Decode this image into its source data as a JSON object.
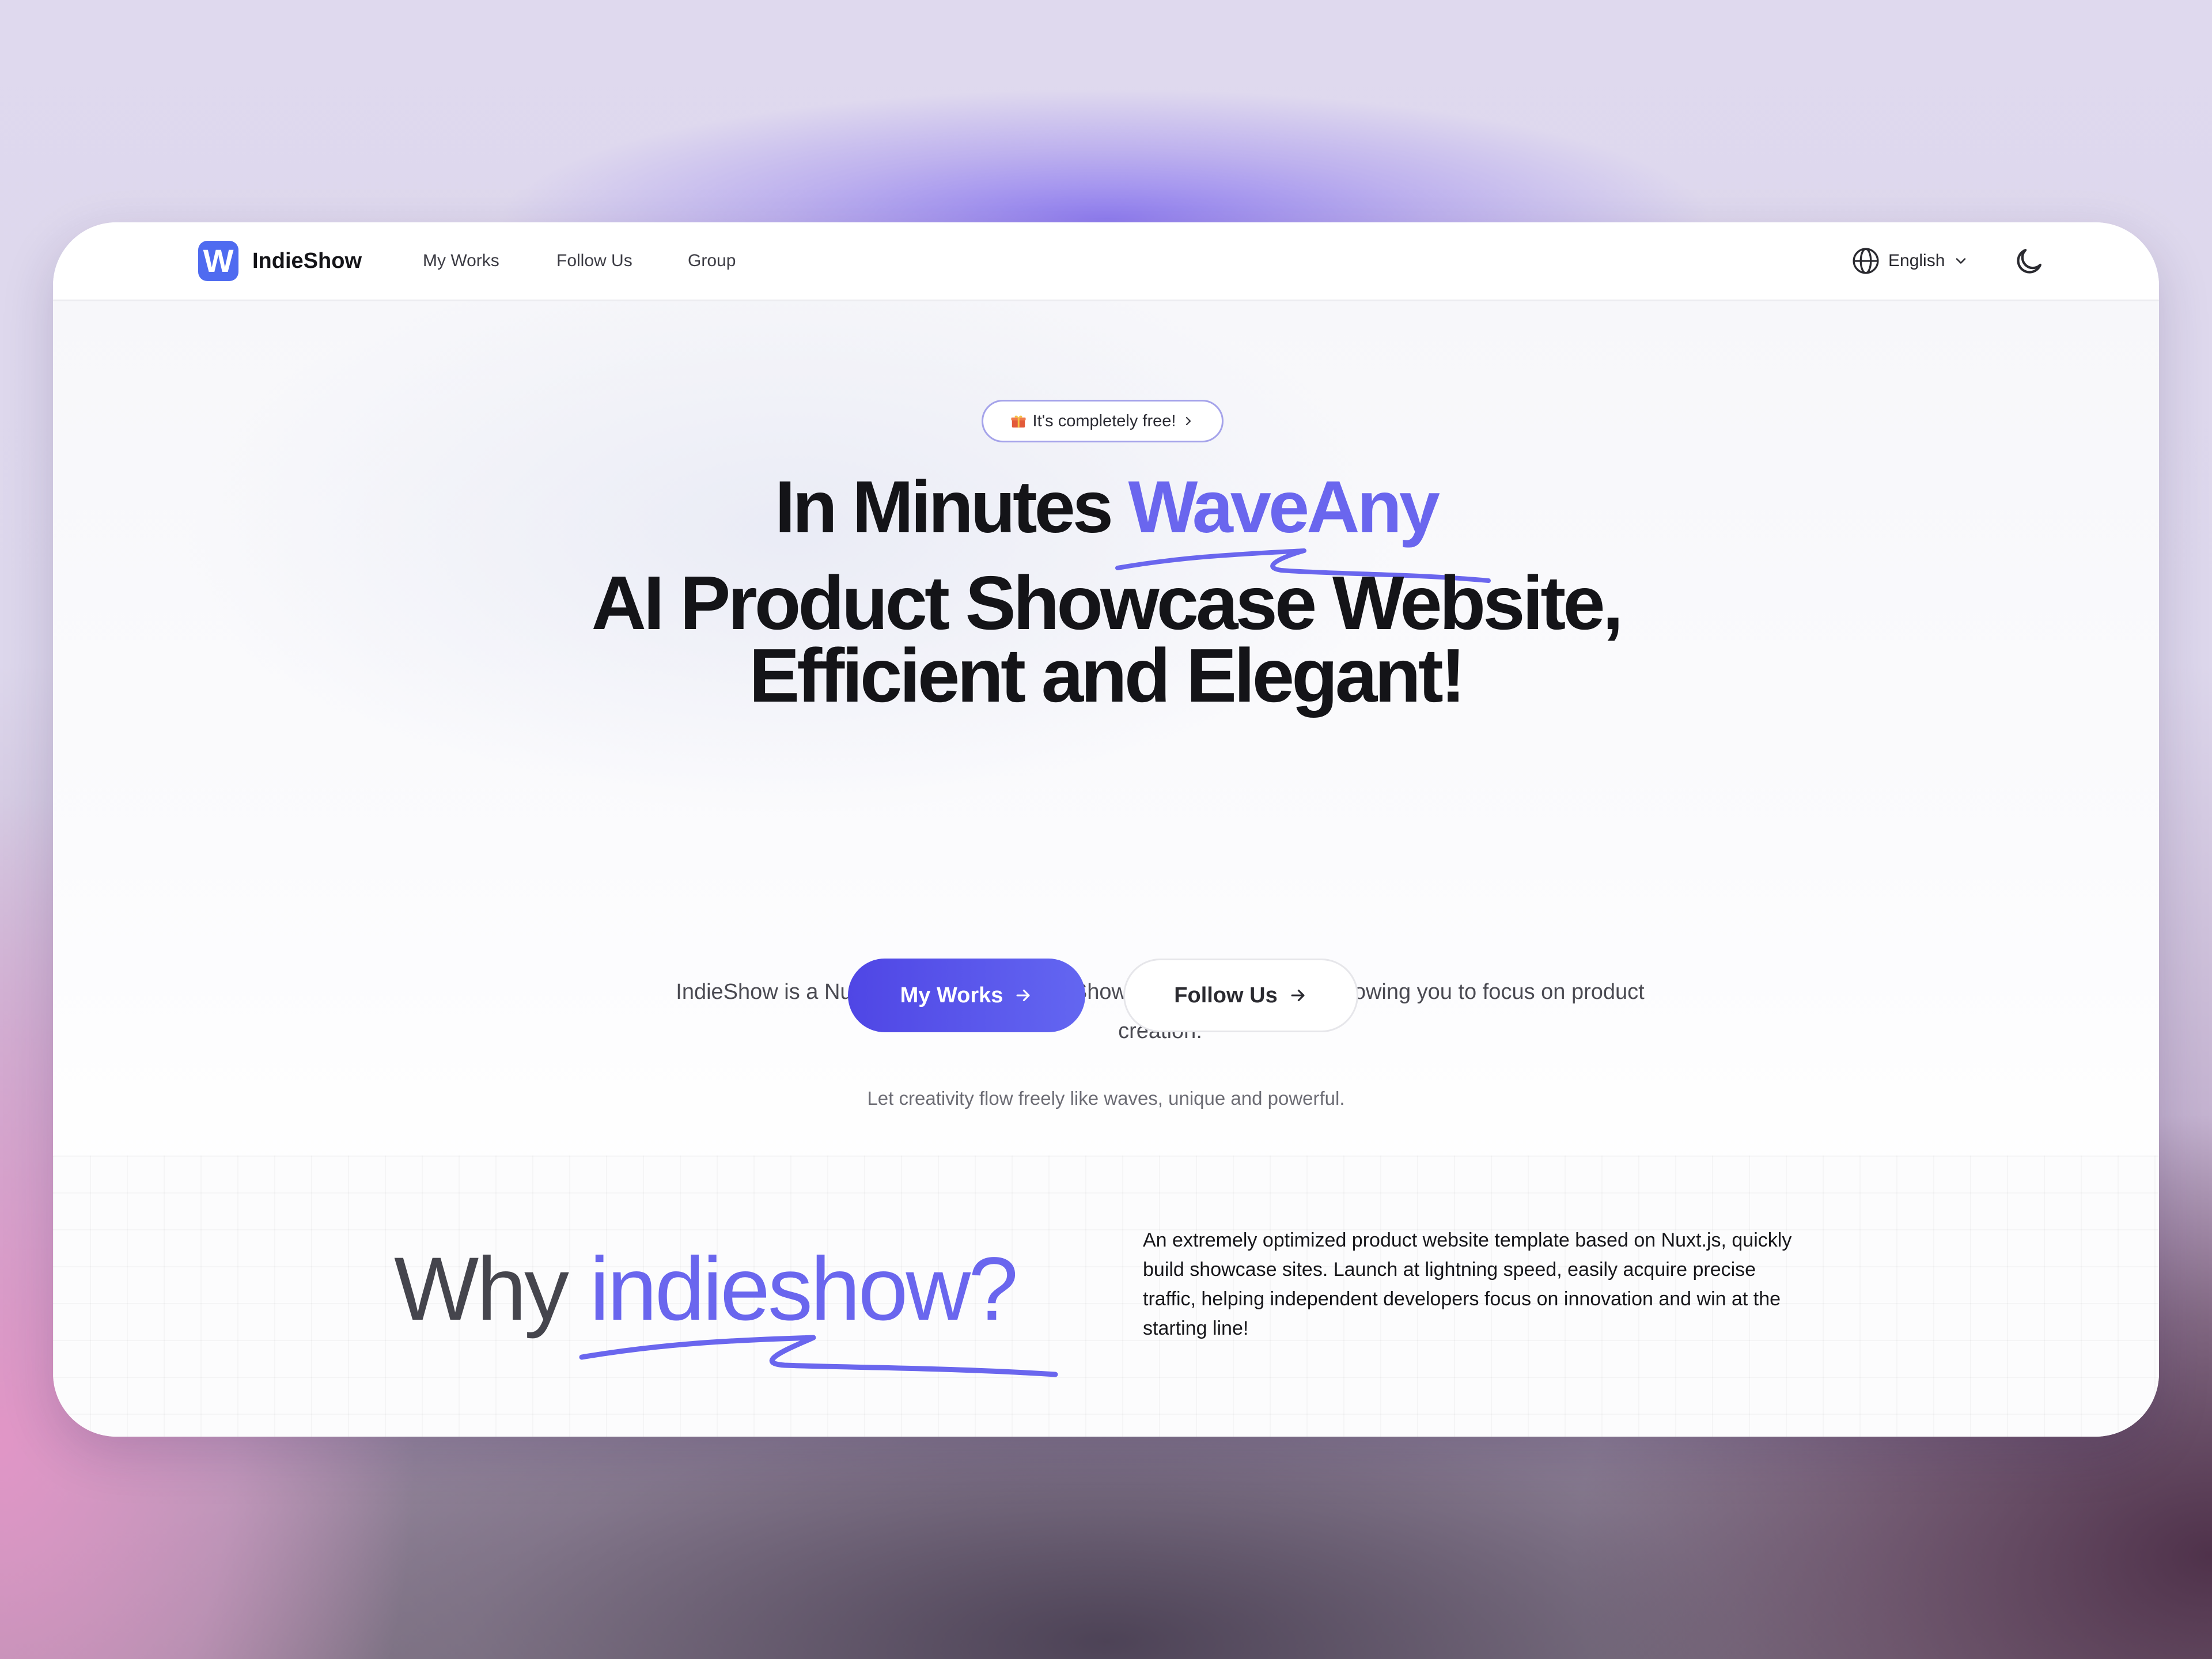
{
  "brand": {
    "logo_letter": "W",
    "name": "IndieShow",
    "accent": "#4f6bf0"
  },
  "nav": {
    "items": [
      "My Works",
      "Follow Us",
      "Group"
    ]
  },
  "header": {
    "language_label": "English",
    "globe_icon": "globe-icon",
    "theme_icon": "moon-icon"
  },
  "hero": {
    "badge": "It's completely free!",
    "title_line1_prefix": "In Minutes ",
    "title_line1_accent": "WaveAny",
    "title_line2": "AI Product Showcase Website,",
    "title_line3": "Efficient and Elegant!",
    "subtitle": "IndieShow is a Nuxt.js template for Indie Show, no coding required, allowing you to focus on product creation.",
    "tagline": "Let creativity flow freely like waves, unique and powerful.",
    "primary_button": "My Works",
    "secondary_button": "Follow Us"
  },
  "why": {
    "prefix": "Why ",
    "accent": "indieshow?",
    "description": "An extremely optimized product website template based on Nuxt.js, quickly build showcase sites. Launch at lightning speed, easily acquire precise traffic, helping independent developers focus on innovation and win at the starting line!"
  },
  "colors": {
    "accent": "#6a66ee",
    "primary_button": "#4f46e5",
    "text": "#141418"
  }
}
